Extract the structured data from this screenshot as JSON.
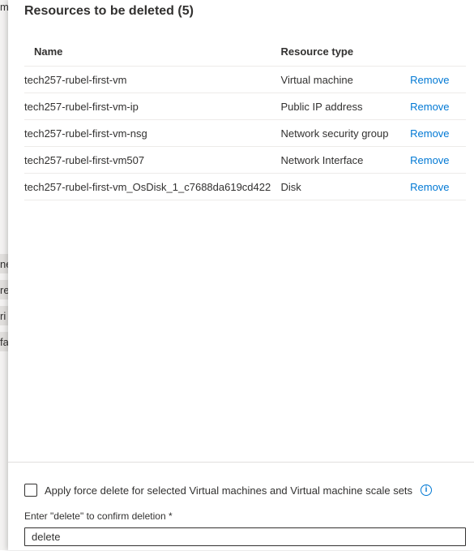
{
  "background": {
    "fragments": [
      "m",
      "ne",
      "re",
      "ri",
      "fa"
    ]
  },
  "panel": {
    "title": "Resources to be deleted (5)",
    "table": {
      "headers": {
        "name": "Name",
        "type": "Resource type"
      },
      "rows": [
        {
          "name": "tech257-rubel-first-vm",
          "type": "Virtual machine",
          "action": "Remove"
        },
        {
          "name": "tech257-rubel-first-vm-ip",
          "type": "Public IP address",
          "action": "Remove"
        },
        {
          "name": "tech257-rubel-first-vm-nsg",
          "type": "Network security group",
          "action": "Remove"
        },
        {
          "name": "tech257-rubel-first-vm507",
          "type": "Network Interface",
          "action": "Remove"
        },
        {
          "name": "tech257-rubel-first-vm_OsDisk_1_c7688da619cd422",
          "type": "Disk",
          "action": "Remove"
        }
      ]
    },
    "footer": {
      "force_delete_label": "Apply force delete for selected Virtual machines and Virtual machine scale sets",
      "force_delete_checked": false,
      "info_icon_glyph": "i",
      "confirm_label": "Enter \"delete\" to confirm deletion *",
      "confirm_value": "delete"
    }
  },
  "colors": {
    "link": "#0078d4",
    "text": "#323130",
    "border": "#edebe9"
  }
}
